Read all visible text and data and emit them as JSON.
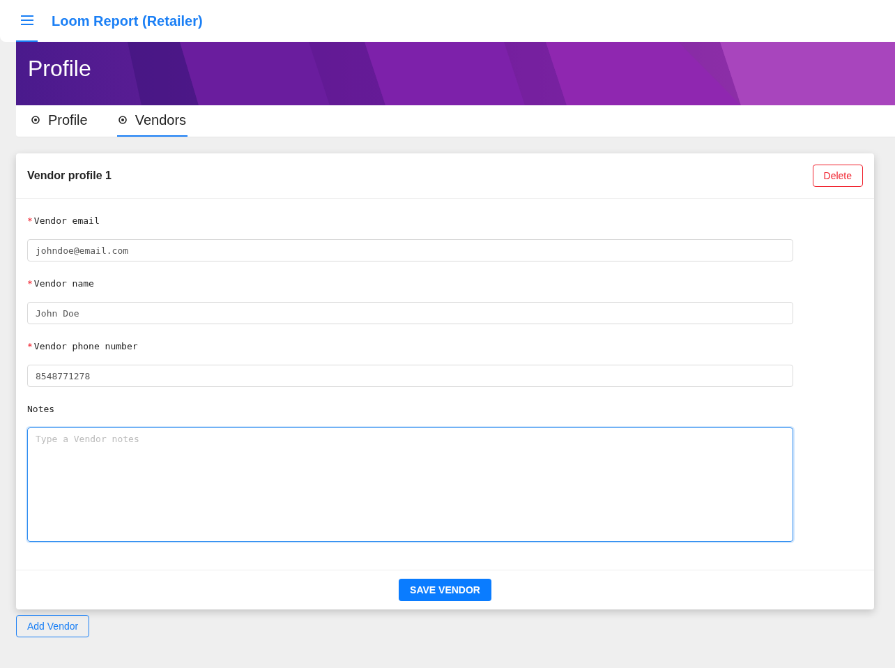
{
  "app_bar": {
    "title": "Loom Report (Retailer)"
  },
  "banner": {
    "title": "Profile",
    "kind": "picture"
  },
  "tabs": [
    {
      "label": "Profile",
      "selected": false
    },
    {
      "label": "Vendors",
      "selected": true
    }
  ],
  "vendor_card": {
    "title": "Vendor profile 1",
    "delete_button": "Delete",
    "fields": [
      {
        "kind": "input",
        "label": "Vendor email",
        "required_mark": "*",
        "value": "johndoe@email.com",
        "focused": false
      },
      {
        "kind": "input",
        "label": "Vendor name",
        "required_mark": "*",
        "value": "John Doe",
        "focused": false
      },
      {
        "kind": "input",
        "label": "Vendor phone number",
        "required_mark": "*",
        "value": "8548771278",
        "focused": false
      },
      {
        "kind": "textarea",
        "label": "Notes",
        "placeholder": "Type a Vendor notes",
        "focused": true
      }
    ],
    "save_button": "SAVE VENDOR"
  },
  "add_button": "Add Vendor"
}
